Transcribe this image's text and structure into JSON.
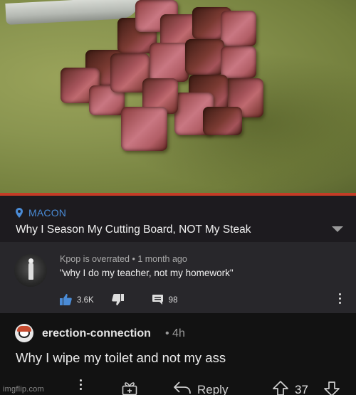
{
  "video": {
    "location": "MACON",
    "title": "Why I Season My Cutting Board, NOT My Steak"
  },
  "yt_comment": {
    "author": "Kpop is overrated",
    "time": "1 month ago",
    "meta_separator": "•",
    "text": "\"why I do my teacher, not my homework\"",
    "likes": "3.6K",
    "replies": "98"
  },
  "reddit_comment": {
    "author": "erection-connection",
    "time": "• 4h",
    "text": "Why I wipe my toilet and not my ass",
    "reply_label": "Reply",
    "score": "37"
  },
  "watermark": "imgflip.com",
  "colors": {
    "location_blue": "#4a8bd6",
    "progress_red": "#c43c26",
    "yt_bg": "#28272b",
    "reddit_bg": "#121212"
  }
}
